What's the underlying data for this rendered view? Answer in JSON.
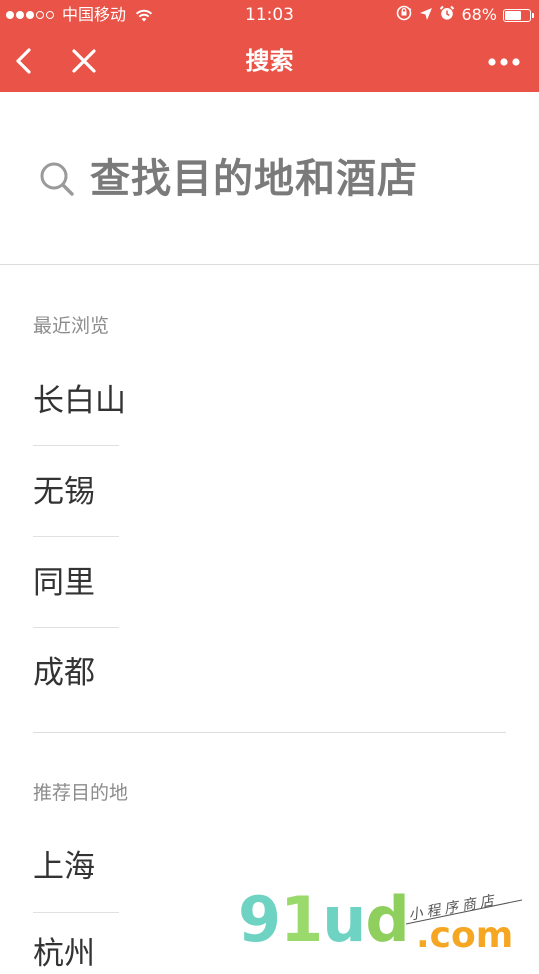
{
  "status_bar": {
    "signal_dots": [
      "full",
      "full",
      "full",
      "empty",
      "empty"
    ],
    "carrier": "中国移动",
    "time": "11:03",
    "battery_percent": "68%",
    "battery_level": 0.68,
    "icons": [
      "wifi-icon",
      "screen-rotation-lock-icon",
      "location-arrow-icon",
      "alarm-icon",
      "battery-icon"
    ]
  },
  "navbar": {
    "title": "搜索",
    "back_icon": "chevron-left-icon",
    "close_icon": "close-icon",
    "more_icon": "more-dots-icon"
  },
  "search": {
    "placeholder": "查找目的地和酒店",
    "icon": "search-icon"
  },
  "recent": {
    "label": "最近浏览",
    "items": [
      {
        "label": "长白山"
      },
      {
        "label": "无锡"
      },
      {
        "label": "同里"
      },
      {
        "label": "成都"
      }
    ]
  },
  "recommended": {
    "label": "推荐目的地",
    "items": [
      {
        "label": "上海"
      },
      {
        "label": "杭州"
      }
    ]
  },
  "watermark": {
    "g": "9",
    "l": "1",
    "u": "u",
    "d": "d",
    "domain": ".com",
    "tagline": "小程序商店",
    "colors": {
      "teal": "#6fd3c3",
      "green": "#9ad96b",
      "orange": "#f5a623"
    }
  },
  "colors": {
    "brand_red": "#ea5347",
    "text_primary": "#333333",
    "text_secondary": "#8c8c8c",
    "placeholder": "#7a7a7a"
  }
}
